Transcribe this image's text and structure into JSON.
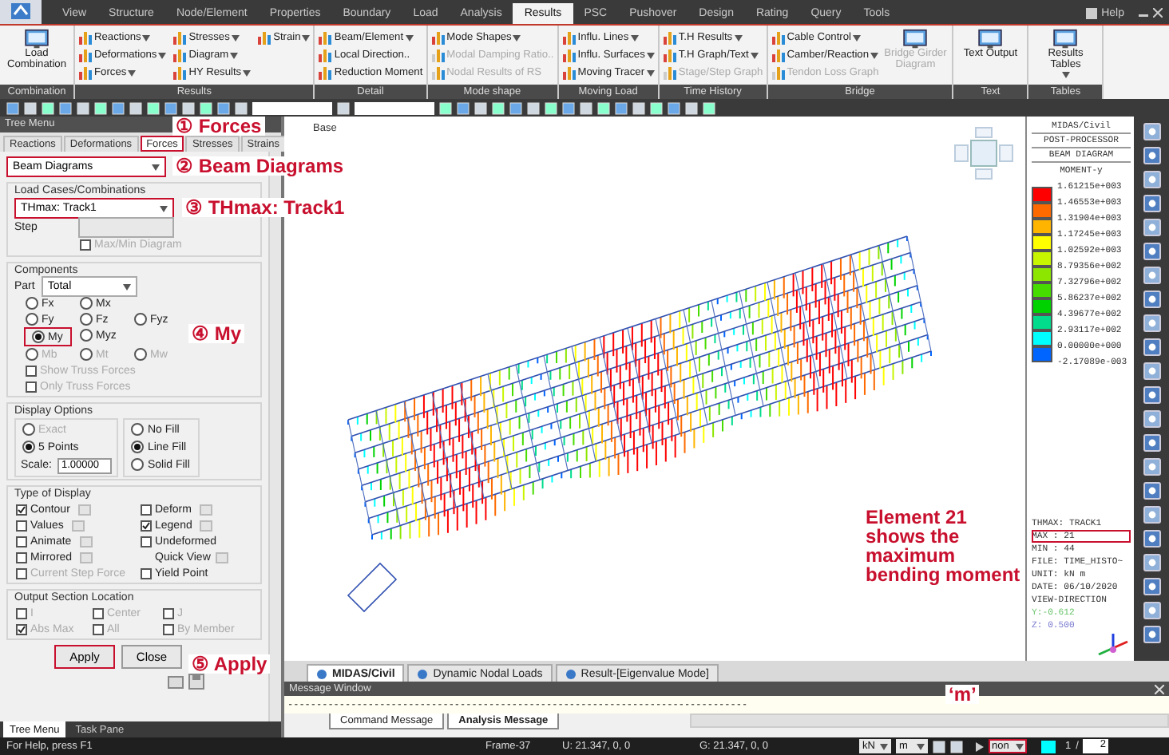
{
  "ribbon_tabs": [
    {
      "label": "View",
      "selected": false
    },
    {
      "label": "Structure",
      "selected": false
    },
    {
      "label": "Node/Element",
      "selected": false
    },
    {
      "label": "Properties",
      "selected": false
    },
    {
      "label": "Boundary",
      "selected": false
    },
    {
      "label": "Load",
      "selected": false
    },
    {
      "label": "Analysis",
      "selected": false
    },
    {
      "label": "Results",
      "selected": true
    },
    {
      "label": "PSC",
      "selected": false
    },
    {
      "label": "Pushover",
      "selected": false
    },
    {
      "label": "Design",
      "selected": false
    },
    {
      "label": "Rating",
      "selected": false
    },
    {
      "label": "Query",
      "selected": false
    },
    {
      "label": "Tools",
      "selected": false
    }
  ],
  "help": "Help",
  "ribbon_groups": [
    {
      "label": "Combination",
      "items": [
        {
          "label": "Load Combination",
          "kind": "large",
          "disabled": false,
          "dropdown": false
        }
      ]
    },
    {
      "label": "Results",
      "items": [
        {
          "label": "Reactions",
          "kind": "small",
          "disabled": false,
          "dropdown": true
        },
        {
          "label": "Deformations",
          "kind": "small",
          "disabled": false,
          "dropdown": true
        },
        {
          "label": "Forces",
          "kind": "small",
          "disabled": false,
          "dropdown": true
        },
        {
          "label": "Stresses",
          "kind": "small",
          "disabled": false,
          "dropdown": true
        },
        {
          "label": "Diagram",
          "kind": "small",
          "disabled": false,
          "dropdown": true
        },
        {
          "label": "HY Results",
          "kind": "small",
          "disabled": false,
          "dropdown": true
        },
        {
          "label": "Strain",
          "kind": "small",
          "disabled": false,
          "dropdown": true
        }
      ]
    },
    {
      "label": "Detail",
      "items": [
        {
          "label": "Beam/Element",
          "kind": "small",
          "disabled": false,
          "dropdown": true
        },
        {
          "label": "Local Direction..",
          "kind": "small",
          "disabled": false,
          "dropdown": false
        },
        {
          "label": "Reduction Moment",
          "kind": "small",
          "disabled": false,
          "dropdown": false
        }
      ]
    },
    {
      "label": "Mode shape",
      "items": [
        {
          "label": "Mode Shapes",
          "kind": "small",
          "disabled": false,
          "dropdown": true
        },
        {
          "label": "Modal Damping Ratio..",
          "kind": "small",
          "disabled": true,
          "dropdown": false
        },
        {
          "label": "Nodal Results of RS",
          "kind": "small",
          "disabled": true,
          "dropdown": false
        }
      ]
    },
    {
      "label": "Moving Load",
      "items": [
        {
          "label": "Influ. Lines",
          "kind": "small",
          "disabled": false,
          "dropdown": true
        },
        {
          "label": "Influ. Surfaces",
          "kind": "small",
          "disabled": false,
          "dropdown": true
        },
        {
          "label": "Moving Tracer",
          "kind": "small",
          "disabled": false,
          "dropdown": true
        }
      ]
    },
    {
      "label": "Time History",
      "items": [
        {
          "label": "T.H Results",
          "kind": "small",
          "disabled": false,
          "dropdown": true
        },
        {
          "label": "T.H Graph/Text",
          "kind": "small",
          "disabled": false,
          "dropdown": true
        },
        {
          "label": "Stage/Step Graph",
          "kind": "small",
          "disabled": true,
          "dropdown": false
        }
      ]
    },
    {
      "label": "Bridge",
      "items": [
        {
          "label": "Cable Control",
          "kind": "small",
          "disabled": false,
          "dropdown": true
        },
        {
          "label": "Camber/Reaction",
          "kind": "small",
          "disabled": false,
          "dropdown": true
        },
        {
          "label": "Tendon Loss Graph",
          "kind": "small",
          "disabled": true,
          "dropdown": false
        },
        {
          "label": "Bridge Girder Diagram",
          "kind": "large",
          "disabled": true,
          "dropdown": false
        }
      ]
    },
    {
      "label": "Text",
      "items": [
        {
          "label": "Text Output",
          "kind": "large",
          "disabled": false,
          "dropdown": false
        }
      ]
    },
    {
      "label": "Tables",
      "items": [
        {
          "label": "Results Tables",
          "kind": "large",
          "disabled": false,
          "dropdown": true
        }
      ]
    }
  ],
  "tree_menu": {
    "title": "Tree Menu",
    "tabs": [
      {
        "label": "Reactions",
        "selected": false,
        "highlighted": false
      },
      {
        "label": "Deformations",
        "selected": false,
        "highlighted": false
      },
      {
        "label": "Forces",
        "selected": true,
        "highlighted": true
      },
      {
        "label": "Stresses",
        "selected": false,
        "highlighted": false
      },
      {
        "label": "Strains",
        "selected": false,
        "highlighted": false
      }
    ],
    "diagram_type": {
      "value": "Beam Diagrams",
      "highlighted": true
    },
    "load_cases": {
      "label": "Load Cases/Combinations",
      "value": "THmax: Track1",
      "highlighted": true,
      "step_label": "Step",
      "max_min": {
        "label": "Max/Min Diagram",
        "checked": false,
        "disabled": true
      }
    },
    "components": {
      "label": "Components",
      "part_label": "Part",
      "part_value": "Total",
      "radio_rows": [
        [
          {
            "label": "Fx",
            "selected": false,
            "disabled": false
          },
          {
            "label": "Mx",
            "selected": false,
            "disabled": false
          }
        ],
        [
          {
            "label": "Fy",
            "selected": false,
            "disabled": false
          },
          {
            "label": "Fz",
            "selected": false,
            "disabled": false
          },
          {
            "label": "Fyz",
            "selected": false,
            "disabled": false
          }
        ],
        [
          {
            "label": "My",
            "selected": true,
            "disabled": false
          },
          {
            "label": "Myz",
            "selected": false,
            "disabled": false
          }
        ],
        [
          {
            "label": "Mb",
            "selected": false,
            "disabled": true
          },
          {
            "label": "Mt",
            "selected": false,
            "disabled": true
          },
          {
            "label": "Mw",
            "selected": false,
            "disabled": true
          }
        ]
      ],
      "checkboxes": [
        {
          "label": "Show Truss Forces",
          "checked": false,
          "disabled": true
        },
        {
          "label": "Only Truss Forces",
          "checked": false,
          "disabled": true
        }
      ]
    },
    "display_options": {
      "label": "Display Options",
      "points": [
        {
          "label": "Exact",
          "selected": false,
          "disabled": true
        },
        {
          "label": "5 Points",
          "selected": true,
          "disabled": false
        }
      ],
      "scale_label": "Scale:",
      "scale_value": "1.00000",
      "fill": [
        {
          "label": "No Fill",
          "selected": false
        },
        {
          "label": "Line Fill",
          "selected": true
        },
        {
          "label": "Solid Fill",
          "selected": false
        }
      ]
    },
    "type_of_display": {
      "label": "Type of Display",
      "items": [
        {
          "label": "Contour",
          "kind": "check",
          "checked": true,
          "disabled": false,
          "options": true
        },
        {
          "label": "Deform",
          "kind": "check",
          "checked": false,
          "disabled": false,
          "options": true
        },
        {
          "label": "Values",
          "kind": "check",
          "checked": false,
          "disabled": false,
          "options": true
        },
        {
          "label": "Legend",
          "kind": "check",
          "checked": true,
          "disabled": false,
          "options": true
        },
        {
          "label": "Animate",
          "kind": "check",
          "checked": false,
          "disabled": false,
          "options": true
        },
        {
          "label": "Undeformed",
          "kind": "check",
          "checked": false,
          "disabled": false,
          "options": false
        },
        {
          "label": "Mirrored",
          "kind": "check",
          "checked": false,
          "disabled": false,
          "options": true
        },
        {
          "label": "Quick View",
          "kind": "label",
          "disabled": false,
          "options": true
        },
        {
          "label": "Current Step Force",
          "kind": "check",
          "checked": false,
          "disabled": true,
          "options": false
        },
        {
          "label": "Yield Point",
          "kind": "check",
          "checked": false,
          "disabled": false,
          "options": false
        }
      ]
    },
    "output_section": {
      "label": "Output Section Location",
      "items": [
        {
          "label": "I",
          "checked": false,
          "disabled": true
        },
        {
          "label": "Center",
          "checked": false,
          "disabled": true
        },
        {
          "label": "J",
          "checked": false,
          "disabled": true
        },
        {
          "label": "Abs Max",
          "checked": true,
          "disabled": true
        },
        {
          "label": "All",
          "checked": false,
          "disabled": true
        },
        {
          "label": "By Member",
          "checked": false,
          "disabled": true
        }
      ]
    },
    "buttons": [
      {
        "label": "Apply",
        "highlighted": true
      },
      {
        "label": "Close",
        "highlighted": false
      }
    ],
    "bottom_tabs": [
      {
        "label": "Tree Menu",
        "selected": true
      },
      {
        "label": "Task Pane",
        "selected": false
      }
    ]
  },
  "canvas_label": "Base",
  "legend": {
    "header": [
      "MIDAS/Civil",
      "POST-PROCESSOR",
      "BEAM DIAGRAM"
    ],
    "quantity": "MOMENT-y",
    "bands": [
      {
        "color": "#ff0000"
      },
      {
        "color": "#ff6a00"
      },
      {
        "color": "#ffb400"
      },
      {
        "color": "#ffff00"
      },
      {
        "color": "#c8f500"
      },
      {
        "color": "#8ce600"
      },
      {
        "color": "#46dc00"
      },
      {
        "color": "#00d200"
      },
      {
        "color": "#00dc8c"
      },
      {
        "color": "#00ffff"
      },
      {
        "color": "#0064ff"
      }
    ],
    "ticks": [
      "1.61215e+003",
      "1.46553e+003",
      "1.31904e+003",
      "1.17245e+003",
      "1.02592e+003",
      "8.79356e+002",
      "7.32796e+002",
      "5.86237e+002",
      "4.39677e+002",
      "2.93117e+002",
      "0.00000e+000",
      "-2.17089e-003"
    ],
    "info": [
      {
        "text": "THMAX: TRACK1",
        "highlighted": false
      },
      {
        "text": "MAX : 21",
        "highlighted": true
      },
      {
        "text": "MIN : 44",
        "highlighted": false
      },
      {
        "text": "FILE: TIME_HISTO~",
        "highlighted": false
      },
      {
        "text": "UNIT: kN m",
        "highlighted": false
      },
      {
        "text": "DATE: 06/10/2020",
        "highlighted": false
      },
      {
        "text": "VIEW-DIRECTION",
        "highlighted": false
      }
    ],
    "direction": [
      {
        "text": "Y:-0.612",
        "color": "#6cc46c"
      },
      {
        "text": "Z: 0.500",
        "color": "#7c7cd0"
      }
    ]
  },
  "doc_tabs": [
    {
      "label": "MIDAS/Civil",
      "selected": true
    },
    {
      "label": "Dynamic Nodal Loads",
      "selected": false
    },
    {
      "label": "Result-[Eigenvalue Mode]",
      "selected": false
    }
  ],
  "message_window": {
    "title": "Message Window",
    "log_line": "--------------------------------------------------------------------------------",
    "tabs": [
      {
        "label": "Command Message",
        "selected": false
      },
      {
        "label": "Analysis Message",
        "selected": true
      }
    ]
  },
  "status_bar": {
    "help": "For Help, press F1",
    "frame": "Frame-37",
    "u": "U: 21.347, 0, 0",
    "g": "G: 21.347, 0, 0",
    "units": [
      {
        "value": "kN",
        "highlighted": false
      },
      {
        "value": "m",
        "highlighted": false
      },
      {
        "value": "non",
        "highlighted": true
      }
    ],
    "page": {
      "current": "1",
      "separator": "/",
      "total": "2"
    }
  },
  "annotations": [
    {
      "lines": [
        "① Forces"
      ]
    },
    {
      "lines": [
        "② Beam Diagrams"
      ]
    },
    {
      "lines": [
        "③ THmax: Track1"
      ]
    },
    {
      "lines": [
        "④ My"
      ]
    },
    {
      "lines": [
        "⑤ Apply"
      ]
    },
    {
      "lines": [
        "Element 21",
        "shows the",
        "maximum",
        "bending moment"
      ]
    },
    {
      "lines": [
        "‘m’"
      ]
    }
  ]
}
